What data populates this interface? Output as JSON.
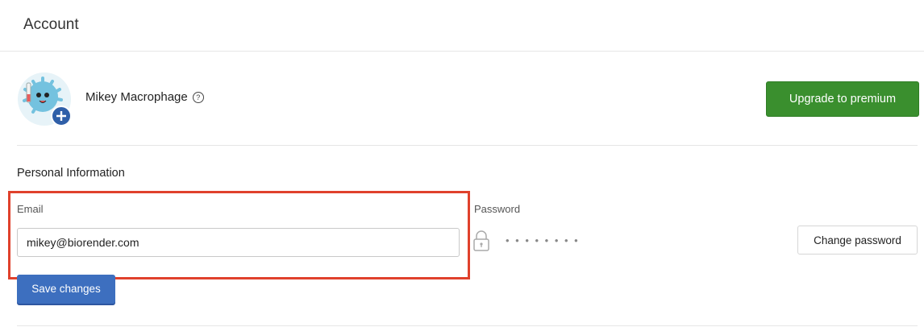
{
  "header": {
    "title": "Account"
  },
  "profile": {
    "name": "Mikey Macrophage",
    "help_icon": "help-circle-icon",
    "avatar_icon": "macrophage-avatar",
    "add_icon": "plus-icon"
  },
  "upgrade": {
    "label": "Upgrade to premium"
  },
  "personal_info": {
    "title": "Personal Information",
    "email_label": "Email",
    "email_value": "mikey@biorender.com",
    "password_label": "Password",
    "password_masked": "• • • • • • • •",
    "change_password_label": "Change password",
    "save_label": "Save changes"
  },
  "colors": {
    "primary_green": "#3a8f2e",
    "primary_blue": "#3d6fbf",
    "highlight_red": "#e0412c"
  }
}
